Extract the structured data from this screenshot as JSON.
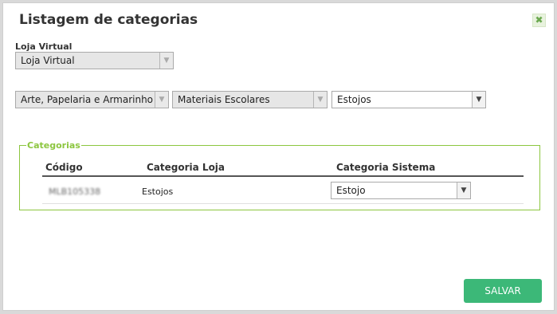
{
  "dialog": {
    "title": "Listagem de categorias",
    "close_icon": "close-icon",
    "save_label": "SALVAR"
  },
  "loja": {
    "label": "Loja Virtual",
    "selected": "Loja Virtual"
  },
  "category_path": {
    "level1": "Arte, Papelaria e Armarinho",
    "level2": "Materiais Escolares",
    "level3": "Estojos"
  },
  "categorias": {
    "legend": "Categorias",
    "columns": [
      "Código",
      "Categoria Loja",
      "Categoria Sistema"
    ],
    "rows": [
      {
        "codigo": "MLB105338",
        "categoria_loja": "Estojos",
        "categoria_sistema": "Estojo"
      }
    ]
  },
  "colors": {
    "accent_green": "#8cc63f",
    "save_button": "#3cb878"
  }
}
